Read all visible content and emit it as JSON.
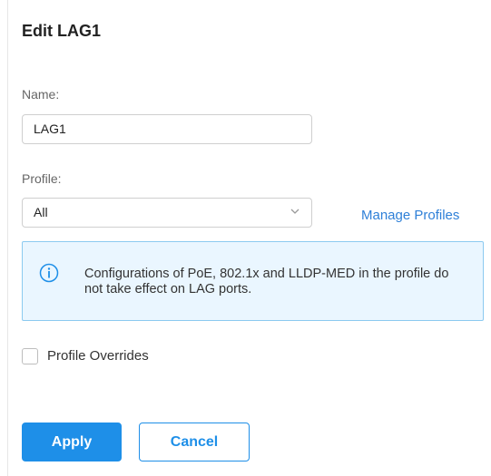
{
  "dialog": {
    "title": "Edit LAG1",
    "name": {
      "label": "Name:",
      "value": "LAG1"
    },
    "profile": {
      "label": "Profile:",
      "selected": "All",
      "manage_link": "Manage Profiles"
    },
    "info": {
      "icon": "info-circle-icon",
      "text": "Configurations of PoE, 802.1x and LLDP-MED in the profile do not take effect on LAG ports."
    },
    "profile_overrides": {
      "label": "Profile Overrides",
      "checked": false
    },
    "buttons": {
      "apply": "Apply",
      "cancel": "Cancel"
    }
  },
  "colors": {
    "accent": "#1e8fe8",
    "link": "#2f80d8",
    "info_bg": "#eaf6ff",
    "info_border": "#8ccaf0"
  }
}
